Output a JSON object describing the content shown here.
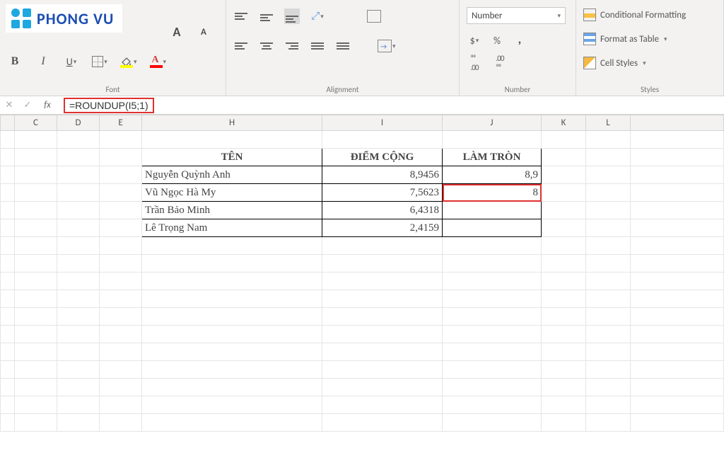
{
  "logo_text": "PHONG VU",
  "ribbon": {
    "font": {
      "label": "Font",
      "bold": "B",
      "italic": "I",
      "underline": "U"
    },
    "alignment": {
      "label": "Alignment"
    },
    "number": {
      "label": "Number",
      "format_selected": "Number",
      "inc": "←.0\n.00",
      "dec": ".00\n→.0"
    },
    "styles": {
      "label": "Styles",
      "conditional": "Conditional Formatting",
      "table": "Format as Table",
      "cell": "Cell Styles"
    }
  },
  "formula_bar": {
    "cancel": "✕",
    "enter": "✓",
    "fx": "fx",
    "formula": "=ROUNDUP(I5;1)"
  },
  "columns": [
    "C",
    "D",
    "E",
    "H",
    "I",
    "J",
    "K",
    "L"
  ],
  "table_headers": {
    "name": "TÊN",
    "score": "ĐIỂM CỘNG",
    "round": "LÀM TRÒN"
  },
  "rows": [
    {
      "name": "Nguyễn Quỳnh Anh",
      "score": "8,9456",
      "round": "8,9"
    },
    {
      "name": "Vũ Ngọc Hà My",
      "score": "7,5623",
      "round": "8"
    },
    {
      "name": "Trần Bảo Minh",
      "score": "6,4318",
      "round": ""
    },
    {
      "name": "Lê Trọng Nam",
      "score": "2,4159",
      "round": ""
    }
  ],
  "chart_data": {
    "type": "table",
    "title": "",
    "columns": [
      "TÊN",
      "ĐIỂM CỘNG",
      "LÀM TRÒN"
    ],
    "data": [
      [
        "Nguyễn Quỳnh Anh",
        8.9456,
        8.9
      ],
      [
        "Vũ Ngọc Hà My",
        7.5623,
        8
      ],
      [
        "Trần Bảo Minh",
        6.4318,
        null
      ],
      [
        "Lê Trọng Nam",
        2.4159,
        null
      ]
    ],
    "formula_example": "=ROUNDUP(I5;1)"
  }
}
